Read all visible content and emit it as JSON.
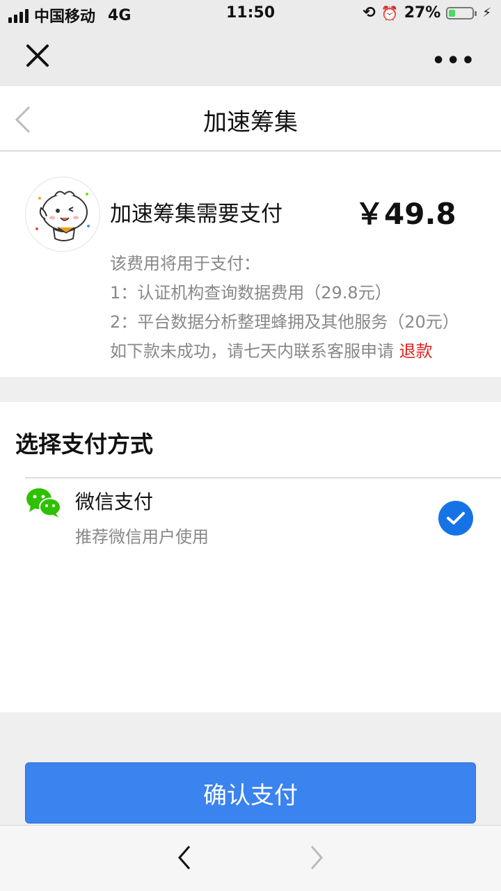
{
  "status_bar": {
    "carrier": "中国移动",
    "network": "4G",
    "time": "11:50",
    "battery_percent": "27%",
    "battery_level": 0.27
  },
  "header": {
    "title": "加速筹集"
  },
  "payment_card": {
    "title": "加速筹集需要支付",
    "price": "￥49.8",
    "description_intro": "该费用将用于支付：",
    "item1": "1：认证机构查询数据费用（29.8元）",
    "item2": "2：平台数据分析整理蜂拥及其他服务（20元）",
    "note": "如下款未成功，请七天内联系客服申请",
    "refund_link": "退款"
  },
  "payment_methods": {
    "heading": "选择支付方式",
    "options": [
      {
        "name": "微信支付",
        "subtitle": "推荐微信用户使用",
        "selected": true,
        "icon": "wechat-icon"
      }
    ]
  },
  "confirm_button": {
    "label": "确认支付"
  },
  "colors": {
    "accent": "#3b83ee",
    "check": "#1673e6",
    "refund": "#e02020",
    "wechat_green": "#2dc100",
    "battery": "#4cd964"
  }
}
